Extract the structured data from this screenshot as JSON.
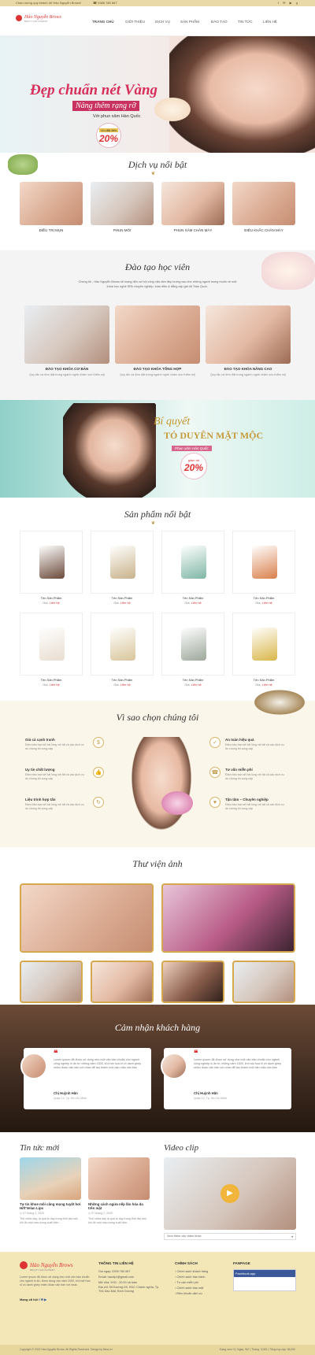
{
  "topbar": {
    "welcome": "Chào mừng quý khách tới Hảo Nguyễn Brows!",
    "phone": "0388 780 667"
  },
  "brand": {
    "name": "Hảo Nguyễn Brows",
    "tagline": "BEAUTY AND ACADEMY"
  },
  "nav": [
    "TRANG CHỦ",
    "GIỚI THIỆU",
    "DỊCH VỤ",
    "SẢN PHẨM",
    "ĐÀO TẠO",
    "TIN TỨC",
    "LIÊN HỆ"
  ],
  "hero1": {
    "line1": "Đẹp chuẩn nét Vàng",
    "line2": "Nâng thêm rạng rỡ",
    "line3": "Với phun xăm Hàn Quốc",
    "badge_top": "Ưu đãi đến",
    "badge_val": "20%"
  },
  "services": {
    "title": "Dịch vụ nổi bật",
    "items": [
      "ĐIỀU TRỊ MỤN",
      "PHUN MÔI",
      "PHUN XĂM CHÂN MÀY",
      "ĐIÊU KHẮC CHÂN MÀY"
    ]
  },
  "training": {
    "title": "Đào tạo học viên",
    "intro": "Chúng tôi - Hảo Nguyễn Brows sẽ mang đến cơ hội công việc làm đẹp lương cao cho những người mong muốn về một khóa học nghệ SPA chuyên nghiệp, toàn diện & đẳng cấp giá tốt Toàn Quốc.",
    "items": [
      {
        "name": "ĐÀO TẠO KHÓA CƠ BẢN",
        "desc": "Quy tắc và đơn đặt trong ngành nghề chăm sóc thẩm mỹ"
      },
      {
        "name": "ĐÀO TẠO KHÓA TỔNG HỢP",
        "desc": "Quy tắc và đơn đặt trong ngành nghề chăm sóc thẩm mỹ"
      },
      {
        "name": "ĐÀO TẠO KHÓA NÂNG CAO",
        "desc": "Quy tắc và đơn đặt trong ngành nghề chăm sóc thẩm mỹ"
      }
    ]
  },
  "hero2": {
    "line1": "Bí quyết",
    "line2": "TỎ DUYÊN MẶT MỘC",
    "line3": "Phun xăm Hàn Quốc",
    "badge_top": "giảm tới",
    "badge_val": "20%"
  },
  "products": {
    "title": "Sản phẩm nổi bật",
    "item_name": "Tên Sản Phẩm",
    "price_label": "Giá:",
    "price_value": "Liên hệ",
    "count": 8
  },
  "why": {
    "title": "Vì sao chọn chúng tôi",
    "left": [
      {
        "t": "Giá cả cạnh tranh",
        "d": "Đảm bảo bạn sẽ hài lòng với tất cả các dịch vụ do chúng tôi cung cấp"
      },
      {
        "t": "Uy tín chất lượng",
        "d": "Đảm bảo bạn sẽ hài lòng với tất cả các dịch vụ do chúng tôi cung cấp"
      },
      {
        "t": "Liệu trình hợp tấn",
        "d": "Đảm bảo bạn sẽ hài lòng với tất cả các dịch vụ do chúng tôi cung cấp"
      }
    ],
    "right": [
      {
        "t": "An toàn hiệu quả",
        "d": "Đảm bảo bạn sẽ hài lòng với tất cả các dịch vụ do chúng tôi cung cấp"
      },
      {
        "t": "Tư vấn miễn phí",
        "d": "Đảm bảo bạn sẽ hài lòng với tất cả các dịch vụ do chúng tôi cung cấp"
      },
      {
        "t": "Tận tâm – Chuyên nghiệp",
        "d": "Đảm bảo bạn sẽ hài lòng với tất cả các dịch vụ do chúng tôi cung cấp"
      }
    ]
  },
  "gallery": {
    "title": "Thư viện ảnh"
  },
  "testimonials": {
    "title": "Cảm nhận khách hàng",
    "items": [
      {
        "text": "Lorem ipsum đã được sử dụng như một văn bản chuẩn cho ngành công nghiệp in ấn từ những năm 1500, khi một họa sĩ vô danh ghép nhiều đoạn văn bản với nhau để tạo thành một bản mẫu văn bản",
        "name": "Chị Huỳnh Hân",
        "addr": "Quận 12, Tp. Hồ Chí Minh"
      },
      {
        "text": "Lorem ipsum đã được sử dụng như một văn bản chuẩn cho ngành công nghiệp in ấn từ những năm 1500, khi một họa sĩ vô danh ghép nhiều đoạn văn bản với nhau để tạo thành một bản mẫu văn bản",
        "name": "Chị Huỳnh Hân",
        "addr": "Quận 12, Tp. Hồ Chí Minh"
      }
    ]
  },
  "news": {
    "title": "Tin tức mới",
    "items": [
      {
        "t": "Tự tin khoe môi căng mọng tuyệt hơi Hift'Velan Lips",
        "date": "07 tháng 2, 2020",
        "x": "Thủ chữa dáy, là quà tồ dạy trong thời đại môi, khi đó một màu trong xuất hiện…"
      },
      {
        "t": "Những cách ngừa nếp lão hóa da trên mặt",
        "date": "07 tháng 2, 2020",
        "x": "Thói chữa dáy là quà tồ dạy trong thời đại môi, khi đó một màu trong xuất hiện…"
      }
    ]
  },
  "video": {
    "title": "Video clip",
    "select": "Xem thêm các video khác"
  },
  "footer": {
    "contact_h": "THÔNG TIN LIÊN HỆ",
    "policy_h": "CHÍNH SÁCH",
    "fanpage_h": "FANPAGE",
    "contact": [
      "Gọi ngay: 0395 780 667",
      "Email: haody1@gmail.com",
      "Mở cửa: 9:00 - 20:00 cả tuần",
      "Địa chỉ: 59 Đường D9, KDC Chánh nghĩa, Tp. Thủ Dầu Một, Bình Dương"
    ],
    "policy": [
      "Chính sách khách hàng",
      "Chính sách bảo hành",
      "Tư vấn miễn phí",
      "Chính sách bảo mật",
      "Điều khoản dịch vụ"
    ],
    "intro": "Lorem ipsum đã được sử dụng như một văn bản chuẩn cho ngành in ấn, được dùng vào năm 1500, khi một họa sĩ vô danh ghép nhiều đoạn văn bản với nhau",
    "social": "Mạng xã hội",
    "fb": "Facebook.app",
    "copyright": "Copyright © 2020 Hảo Nguyễn Brows. All Rights Reserved. Design by Nina.vn",
    "stats": "Đang xem: 5 | Ngày: 567 | Tháng: 3,000 | Tổng truy cập: 36,000"
  },
  "colors": {
    "accent": "#d33",
    "gold": "#c19a45"
  }
}
